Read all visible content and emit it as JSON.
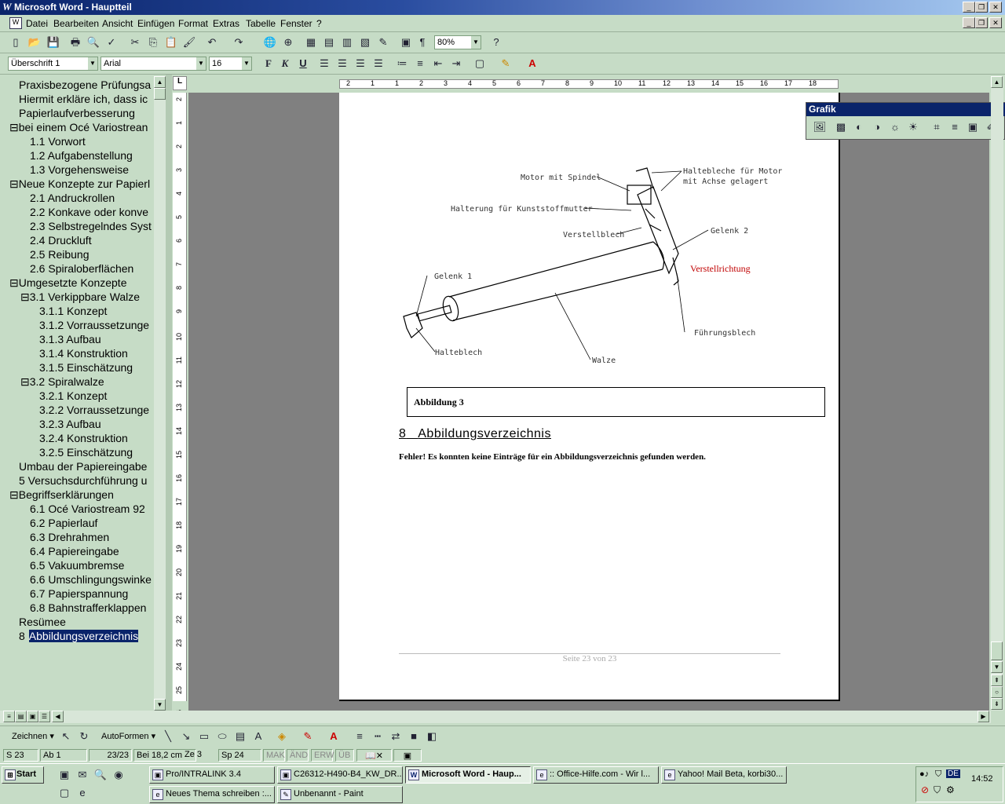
{
  "window": {
    "title": "Microsoft Word - Hauptteil",
    "min": "_",
    "max": "❐",
    "close": "✕"
  },
  "menu": [
    "Datei",
    "Bearbeiten",
    "Ansicht",
    "Einfügen",
    "Format",
    "Extras",
    "Tabelle",
    "Fenster",
    "?"
  ],
  "toolbar": {
    "zoom": "80%",
    "style": "Überschrift 1",
    "font": "Arial",
    "size": "16",
    "bold": "F",
    "italic": "K",
    "underline": "U"
  },
  "nav": {
    "items": [
      {
        "label": "Praxisbezogene Prüfungsa",
        "level": 0,
        "sign": ""
      },
      {
        "label": "Hiermit erkläre ich, dass ic",
        "level": 0,
        "sign": ""
      },
      {
        "label": "Papierlaufverbesserung",
        "level": 0,
        "sign": ""
      },
      {
        "label": "bei einem Océ Variostrean",
        "level": 0,
        "sign": "⊟"
      },
      {
        "label": "1.1 Vorwort",
        "level": 1,
        "sign": ""
      },
      {
        "label": "1.2 Aufgabenstellung",
        "level": 1,
        "sign": ""
      },
      {
        "label": "1.3 Vorgehensweise",
        "level": 1,
        "sign": ""
      },
      {
        "label": "Neue Konzepte zur Papierl",
        "level": 0,
        "sign": "⊟"
      },
      {
        "label": "2.1 Andruckrollen",
        "level": 1,
        "sign": ""
      },
      {
        "label": "2.2 Konkave oder konve",
        "level": 1,
        "sign": ""
      },
      {
        "label": "2.3 Selbstregelndes Syst",
        "level": 1,
        "sign": ""
      },
      {
        "label": "2.4 Druckluft",
        "level": 1,
        "sign": ""
      },
      {
        "label": "2.5 Reibung",
        "level": 1,
        "sign": ""
      },
      {
        "label": "2.6 Spiraloberflächen",
        "level": 1,
        "sign": ""
      },
      {
        "label": "Umgesetzte Konzepte",
        "level": 0,
        "sign": "⊟"
      },
      {
        "label": "3.1 Verkippbare Walze",
        "level": 1,
        "sign": "⊟"
      },
      {
        "label": "3.1.1 Konzept",
        "level": 2,
        "sign": ""
      },
      {
        "label": "3.1.2 Vorraussetzunge",
        "level": 2,
        "sign": ""
      },
      {
        "label": "3.1.3 Aufbau",
        "level": 2,
        "sign": ""
      },
      {
        "label": "3.1.4 Konstruktion",
        "level": 2,
        "sign": ""
      },
      {
        "label": "3.1.5 Einschätzung",
        "level": 2,
        "sign": ""
      },
      {
        "label": "3.2 Spiralwalze",
        "level": 1,
        "sign": "⊟"
      },
      {
        "label": "3.2.1 Konzept",
        "level": 2,
        "sign": ""
      },
      {
        "label": "3.2.2 Vorraussetzunge",
        "level": 2,
        "sign": ""
      },
      {
        "label": "3.2.3 Aufbau",
        "level": 2,
        "sign": ""
      },
      {
        "label": "3.2.4 Konstruktion",
        "level": 2,
        "sign": ""
      },
      {
        "label": "3.2.5 Einschätzung",
        "level": 2,
        "sign": ""
      },
      {
        "label": "Umbau der Papiereingabe",
        "level": 0,
        "sign": ""
      },
      {
        "label": "5 Versuchsdurchführung u",
        "level": 0,
        "sign": ""
      },
      {
        "label": "Begriffserklärungen",
        "level": 0,
        "sign": "⊟"
      },
      {
        "label": "6.1 Océ Variostream 92",
        "level": 1,
        "sign": ""
      },
      {
        "label": "6.2 Papierlauf",
        "level": 1,
        "sign": ""
      },
      {
        "label": "6.3 Drehrahmen",
        "level": 1,
        "sign": ""
      },
      {
        "label": "6.4 Papiereingabe",
        "level": 1,
        "sign": ""
      },
      {
        "label": "6.5 Vakuumbremse",
        "level": 1,
        "sign": ""
      },
      {
        "label": "6.6 Umschlingungswinke",
        "level": 1,
        "sign": ""
      },
      {
        "label": "6.7 Papierspannung",
        "level": 1,
        "sign": ""
      },
      {
        "label": "6.8 Bahnstrafferklappen",
        "level": 1,
        "sign": ""
      },
      {
        "label": "Resümee",
        "level": 0,
        "sign": ""
      },
      {
        "label": "Abbildungsverzeichnis",
        "level": 0,
        "sign": "8",
        "selected": true
      }
    ]
  },
  "ruler": {
    "h": [
      "2",
      "1",
      "1",
      "2",
      "3",
      "4",
      "5",
      "6",
      "7",
      "8",
      "9",
      "10",
      "11",
      "12",
      "13",
      "14",
      "15",
      "16",
      "17",
      "18"
    ],
    "v": [
      "2",
      "1",
      "2",
      "3",
      "4",
      "5",
      "6",
      "7",
      "8",
      "9",
      "10",
      "11",
      "12",
      "13",
      "14",
      "15",
      "16",
      "17",
      "18",
      "19",
      "20",
      "21",
      "22",
      "23",
      "24",
      "25",
      "26",
      "27"
    ]
  },
  "document": {
    "labels": {
      "motor": "Motor mit Spindel",
      "halterung": "Halterung für Kunststoffmutter",
      "verstellblech": "Verstellblech",
      "haltebleche1": "Haltebleche für Motor",
      "haltebleche2": "mit Achse gelagert",
      "gelenk2": "Gelenk 2",
      "verstellrichtung": "Verstellrichtung",
      "gelenk1": "Gelenk 1",
      "halteblech": "Halteblech",
      "walze": "Walze",
      "fuehrungsblech": "Führungsblech"
    },
    "caption": "Abbildung 3",
    "heading_num": "8",
    "heading": "Abbildungsverzeichnis",
    "error": "Fehler! Es konnten keine Einträge für ein Abbildungsverzeichnis gefunden werden.",
    "footer": "Seite 23 von 23"
  },
  "grafik": {
    "title": "Grafik"
  },
  "drawbar": {
    "zeichnen": "Zeichnen",
    "autoformen": "AutoFormen"
  },
  "status": {
    "s": "S 23",
    "ab": "Ab 1",
    "pages": "23/23",
    "pos": "Bei 18,2 cm",
    "ze": "Ze 3",
    "sp": "Sp 24",
    "mak": "MAK",
    "and": "ÄND",
    "erw": "ERW",
    "ub": "ÜB"
  },
  "taskbar": {
    "start": "Start",
    "clock": "14:52",
    "lang": "DE",
    "tasks": [
      "Pro/INTRALINK 3.4",
      "C26312-H490-B4_KW_DR...",
      "Microsoft Word - Haup...",
      ":: Office-Hilfe.com - Wir l...",
      "Yahoo! Mail Beta, korbi30...",
      "Neues Thema schreiben :...",
      "Unbenannt - Paint"
    ]
  },
  "colors": {
    "accent": "#0a246a",
    "chrome": "#c6dcc6",
    "red": "#c00000"
  }
}
